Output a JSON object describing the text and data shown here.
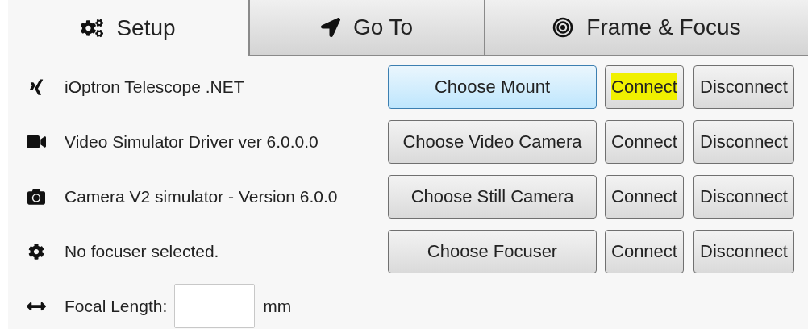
{
  "tabs": [
    {
      "label": "Setup",
      "selected": true
    },
    {
      "label": "Go To",
      "selected": false
    },
    {
      "label": "Frame & Focus",
      "selected": false
    }
  ],
  "devices": [
    {
      "name": "iOptron Telescope .NET",
      "choose": {
        "label": "Choose Mount",
        "focused": true
      },
      "connect": {
        "label": "Connect",
        "highlighted": true
      },
      "disconnect": {
        "label": "Disconnect"
      }
    },
    {
      "name": "Video Simulator Driver ver 6.0.0.0",
      "choose": {
        "label": "Choose Video Camera",
        "focused": false
      },
      "connect": {
        "label": "Connect",
        "highlighted": false
      },
      "disconnect": {
        "label": "Disconnect"
      }
    },
    {
      "name": "Camera V2 simulator - Version 6.0.0",
      "choose": {
        "label": "Choose Still Camera",
        "focused": false
      },
      "connect": {
        "label": "Connect",
        "highlighted": false
      },
      "disconnect": {
        "label": "Disconnect"
      }
    },
    {
      "name": "No focuser selected.",
      "choose": {
        "label": "Choose Focuser",
        "focused": false
      },
      "connect": {
        "label": "Connect",
        "highlighted": false
      },
      "disconnect": {
        "label": "Disconnect"
      }
    }
  ],
  "focal_length": {
    "label": "Focal Length:",
    "unit": "mm"
  }
}
